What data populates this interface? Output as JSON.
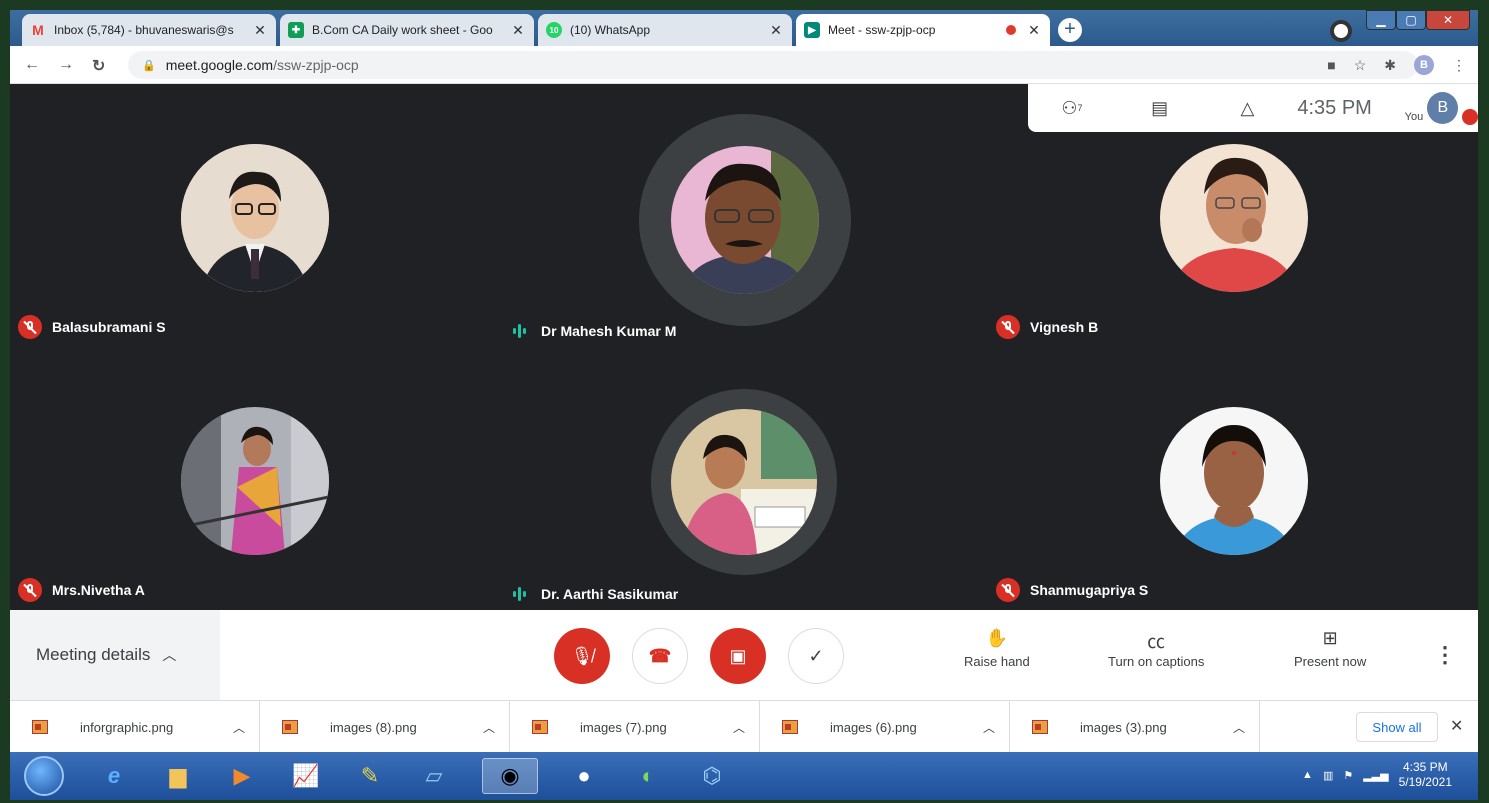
{
  "tabs": [
    {
      "title": "Inbox (5,784) - bhuvaneswaris@s",
      "icon": "gmail-icon",
      "color": "#ea4335"
    },
    {
      "title": "B.Com CA Daily work sheet - Goo",
      "icon": "sheets-icon",
      "color": "#0f9d58"
    },
    {
      "title": "(10) WhatsApp",
      "icon": "whatsapp-icon",
      "color": "#25d366",
      "badge": "10"
    },
    {
      "title": "Meet - ssw-zpjp-ocp",
      "icon": "meet-icon",
      "color": "#00897b"
    }
  ],
  "address": {
    "host": "meet.google.com",
    "path": "/ssw-zpjp-ocp"
  },
  "profile_initial": "B",
  "participants": [
    {
      "name": "Balasubramani S",
      "muted": true,
      "speaking": false,
      "skin": "#e8c2a0",
      "bg": "#d8cfc3"
    },
    {
      "name": "Dr Mahesh Kumar M",
      "muted": false,
      "speaking": true,
      "skin": "#7a4a30",
      "bg": "#e9b7d4"
    },
    {
      "name": "Vignesh B",
      "muted": true,
      "speaking": false,
      "skin": "#c98c6b",
      "bg": "#f3e3d3"
    },
    {
      "name": "Mrs.Nivetha A",
      "muted": true,
      "speaking": false,
      "skin": "#b27a5a",
      "bg": "#9c9fa8"
    },
    {
      "name": "Dr. Aarthi Sasikumar",
      "muted": false,
      "speaking": true,
      "skin": "#b77c55",
      "bg": "#d9c6a3"
    },
    {
      "name": "Shanmugapriya S",
      "muted": true,
      "speaking": false,
      "skin": "#9a6244",
      "bg": "#f4f4f4"
    }
  ],
  "info_panel": {
    "people_count": "7",
    "time": "4:35 PM",
    "you_label": "You",
    "you_initial": "B"
  },
  "controls": {
    "meeting_details": "Meeting details",
    "raise_hand": "Raise hand",
    "captions": "Turn on captions",
    "present": "Present now"
  },
  "downloads": [
    {
      "name": "inforgraphic.png"
    },
    {
      "name": "images (8).png"
    },
    {
      "name": "images (7).png"
    },
    {
      "name": "images (6).png"
    },
    {
      "name": "images (3).png"
    }
  ],
  "show_all": "Show all",
  "taskbar": {
    "time": "4:35 PM",
    "date": "5/19/2021"
  }
}
